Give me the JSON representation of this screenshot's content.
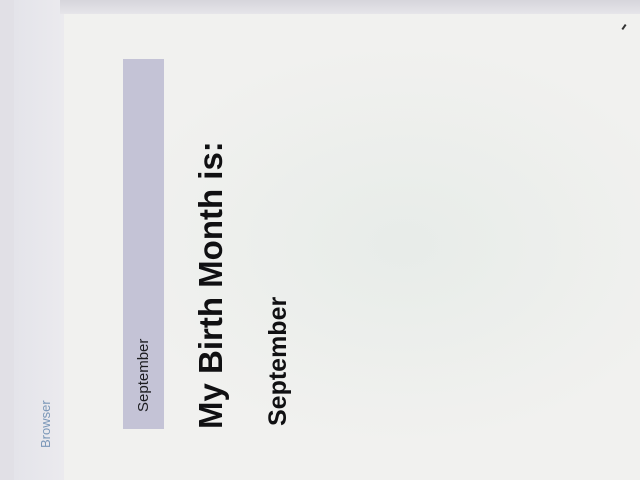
{
  "browser": {
    "label": "Browser"
  },
  "page": {
    "select": {
      "selected_value": "September"
    },
    "heading": "My Birth Month is:",
    "answer": "September"
  },
  "colors": {
    "select_bar": "#c4c3d6",
    "browser_label": "#7b97b8",
    "text": "#101012"
  }
}
